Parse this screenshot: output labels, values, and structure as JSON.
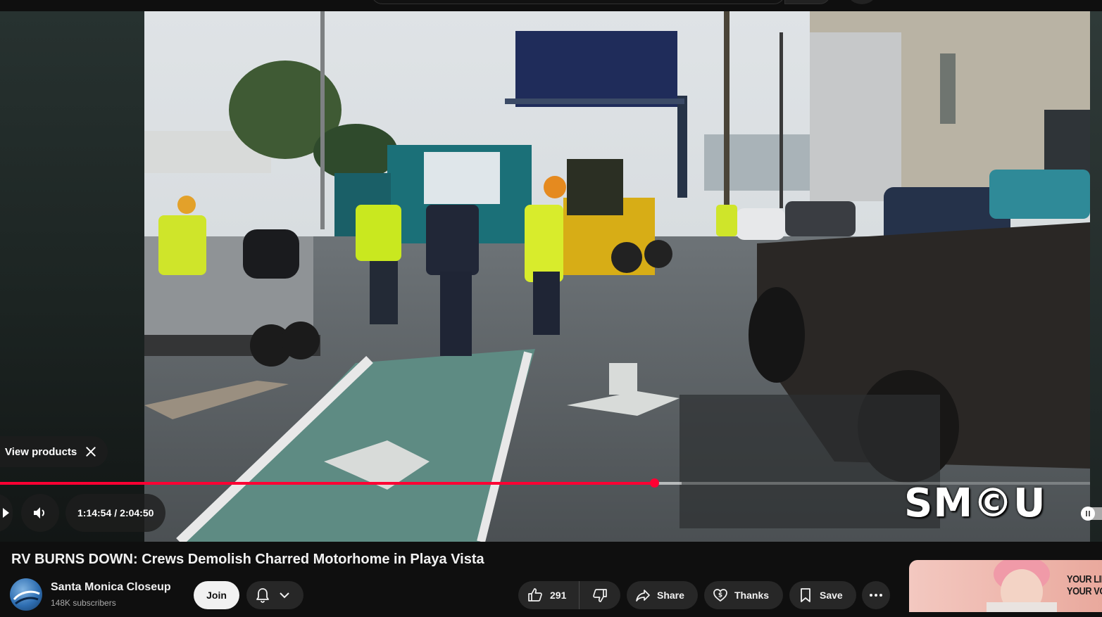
{
  "video": {
    "title_prefix": "RV BURNS DOWN:",
    "title_rest": " Crews Demolish Charred Motorhome in Playa Vista",
    "watermark": "SM©U",
    "overlay_button": "View products"
  },
  "player": {
    "current_time": "1:14:54",
    "separator": "/",
    "duration": "2:04:50",
    "progress_fraction": 0.6,
    "buffered_fraction": 0.625,
    "accent_color": "#ff0033",
    "volume_icon": "volume-half-icon",
    "autoplay": "paused"
  },
  "channel": {
    "name": "Santa Monica Closeup",
    "subscribers": "148K subscribers",
    "join_label": "Join",
    "bell_icon": "bell-icon"
  },
  "actions": {
    "like_count": "291",
    "share_label": "Share",
    "thanks_label": "Thanks",
    "save_label": "Save"
  },
  "ad": {
    "line1": "YOUR LIFE",
    "line2": "YOUR VOL"
  }
}
